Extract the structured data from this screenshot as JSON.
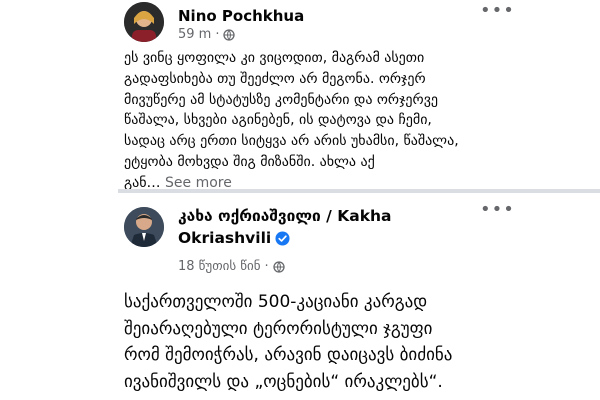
{
  "post1": {
    "author": "Nino Pochkhua",
    "time": "59 m",
    "more_glyph": "•••",
    "text": "ეს ვინც ყოფილა კი ვიცოდით, მაგრამ ასეთი\nგადაფსიხება თუ შეეძლო არ მეგონა. ორჯერ\nმივუწერე ამ სტატუსზე კომენტარი და ორჯერვე\nწაშალა, სხვები აგინებენ, ის დატოვა და ჩემი,\nსადაც არც ერთი სიტყვა არ არის უხამსი, წაშალა,\nეტყობა მოხვდა შიგ მიზანში. ახლა აქ\nგან… ",
    "see_more": "See more"
  },
  "post2": {
    "author_line1": "კახა ოქრიაშვილი / Kakha",
    "author_line2": "Okriashvili",
    "time": "18 წუთის წინ",
    "more_glyph": "•••",
    "text": "საქართველოში 500-კაციანი კარგად\nშეიარაღებული ტერორისტული ჯგუფი\nრომ შემოიჭრას, არავინ დაიცავს ბიძინა\nივანიშვილს და „ოცნების“ ირაკლებს“."
  },
  "colors": {
    "verified": "#1877f2",
    "secondary_text": "#65676b",
    "divider": "#dadde1"
  },
  "icons": {
    "privacy": "globe-icon",
    "verified": "verified-badge-icon",
    "more": "more-options-icon"
  }
}
